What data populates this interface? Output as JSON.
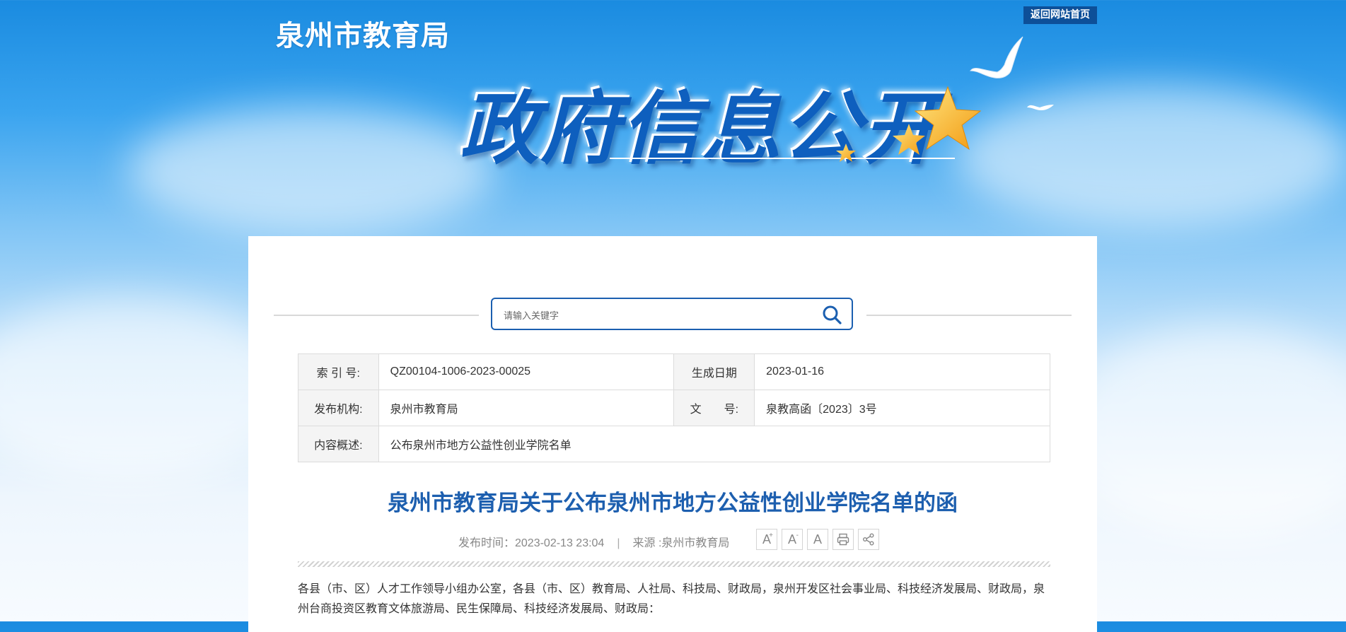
{
  "header": {
    "site_name": "泉州市教育局",
    "home_button": "返回网站首页",
    "banner_title": "政府信息公开"
  },
  "search": {
    "placeholder": "请输入关键字"
  },
  "meta": {
    "index_label": "索 引 号:",
    "index_value": "QZ00104-1006-2023-00025",
    "date_label": "生成日期",
    "date_value": "2023-01-16",
    "org_label": "发布机构:",
    "org_value": "泉州市教育局",
    "doc_label": "文　　号:",
    "doc_value": "泉教高函〔2023〕3号",
    "summary_label": "内容概述:",
    "summary_value": "公布泉州市地方公益性创业学院名单"
  },
  "article": {
    "title": "泉州市教育局关于公布泉州市地方公益性创业学院名单的函",
    "publish_time": "发布时间：2023-02-13 23:04",
    "separator": "|",
    "source": "来源 :泉州市教育局",
    "body": "各县（市、区）人才工作领导小组办公室，各县（市、区）教育局、人社局、科技局、财政局，泉州开发区社会事业局、科技经济发展局、财政局，泉州台商投资区教育文体旅游局、民生保障局、科技经济发展局、财政局："
  },
  "tools": {
    "font_up": "A",
    "font_up_mark": "+",
    "font_down": "A",
    "font_down_mark": "-",
    "font_reset": "A",
    "print_icon": "printer-icon",
    "share_icon": "share-icon"
  },
  "colors": {
    "accent": "#1d5faf",
    "home_button_bg": "#0d4f98",
    "banner_title": "#0e5fbe"
  }
}
